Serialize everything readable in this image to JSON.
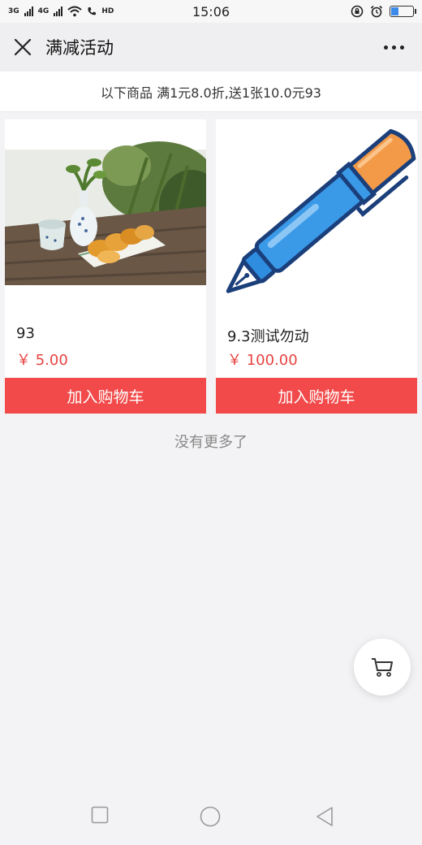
{
  "status": {
    "net1": "3G",
    "net2": "4G",
    "hd": "HD",
    "time": "15:06"
  },
  "nav": {
    "title": "满减活动",
    "icons": [
      "close-icon",
      "more-icon"
    ]
  },
  "promo": {
    "text": "以下商品 满1元8.0折,送1张10.0元93"
  },
  "products": [
    {
      "name": "93",
      "price": "￥ 5.00",
      "button": "加入购物车",
      "image": "mooncake-tea-photo"
    },
    {
      "name": "9.3测试勿动",
      "price": "￥ 100.00",
      "button": "加入购物车",
      "image": "pen-illustration"
    }
  ],
  "footer": {
    "no_more": "没有更多了"
  },
  "colors": {
    "accent": "#f24a4a",
    "price": "#e64340",
    "background": "#f3f3f5"
  }
}
